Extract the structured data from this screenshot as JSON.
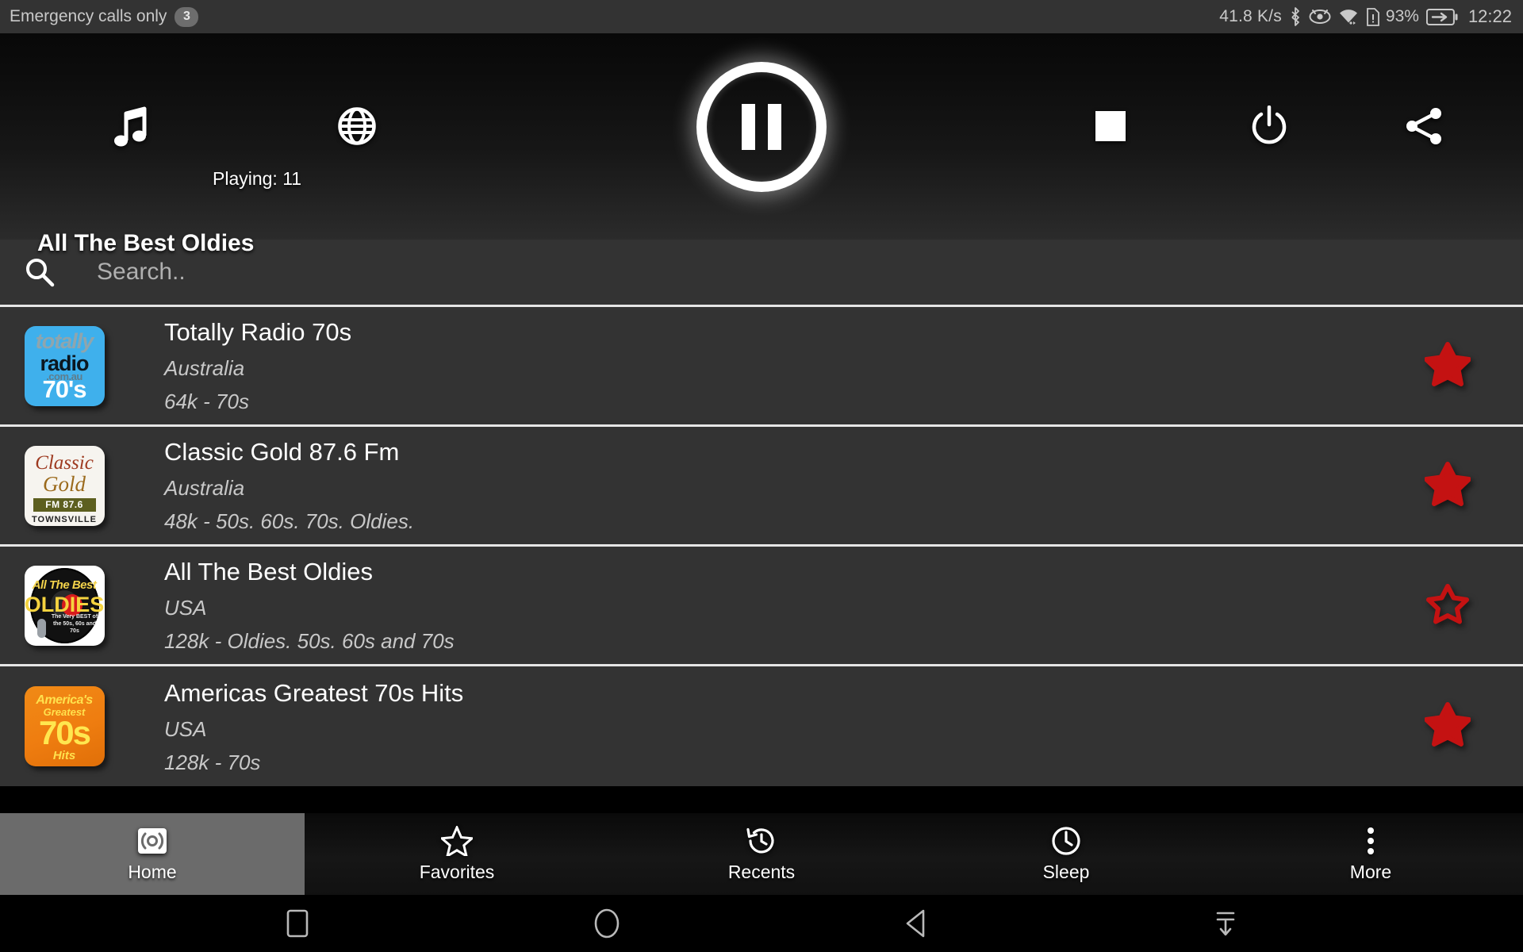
{
  "status_bar": {
    "carrier_text": "Emergency calls only",
    "badge": "3",
    "network_speed": "41.8 K/s",
    "battery_percent": "93%",
    "clock": "12:22",
    "icons": [
      "bluetooth-icon",
      "eye-icon",
      "wifi-icon",
      "sim-alert-icon",
      "battery-charging-icon"
    ]
  },
  "player": {
    "playing_label": "Playing: 11",
    "now_playing_title": "All The Best Oldies",
    "transport_state": "pause",
    "controls": {
      "music": "music-note-icon",
      "globe": "globe-icon",
      "play_pause": "pause-icon",
      "stop": "stop-icon",
      "power": "power-icon",
      "share": "share-icon"
    }
  },
  "search": {
    "placeholder": "Search..",
    "value": "",
    "icon": "search-icon"
  },
  "stations": [
    {
      "name": "Totally Radio 70s",
      "country": "Australia",
      "bitrate_genre": "64k - 70s",
      "favorite": true,
      "logo": {
        "type": "totally",
        "line1": "totally",
        "line2": "radio",
        "line3": ".com.au",
        "line4": "70's"
      }
    },
    {
      "name": "Classic Gold 87.6 Fm",
      "country": "Australia",
      "bitrate_genre": "48k - 50s. 60s. 70s. Oldies.",
      "favorite": true,
      "logo": {
        "type": "classic",
        "line1": "Classic",
        "line2": "Gold",
        "line3": "FM 87.6",
        "line4": "TOWNSVILLE"
      }
    },
    {
      "name": "All The Best Oldies",
      "country": "USA",
      "bitrate_genre": "128k - Oldies. 50s. 60s and 70s",
      "favorite": false,
      "logo": {
        "type": "oldies",
        "line1": "All The Best",
        "line2": "OLDIES",
        "line3": "The Very BEST of the 50s, 60s and 70s"
      }
    },
    {
      "name": "Americas Greatest 70s Hits",
      "country": "USA",
      "bitrate_genre": "128k - 70s",
      "favorite": true,
      "logo": {
        "type": "seventies",
        "line1": "America's",
        "line2": "Greatest",
        "line3": "70s",
        "line4": "Hits"
      }
    }
  ],
  "bottom_nav": {
    "items": [
      {
        "label": "Home",
        "icon": "broadcast-icon",
        "active": true
      },
      {
        "label": "Favorites",
        "icon": "star-outline-icon",
        "active": false
      },
      {
        "label": "Recents",
        "icon": "history-icon",
        "active": false
      },
      {
        "label": "Sleep",
        "icon": "clock-icon",
        "active": false
      },
      {
        "label": "More",
        "icon": "overflow-menu-icon",
        "active": false
      }
    ]
  },
  "android_nav": {
    "buttons": [
      "recents-square-icon",
      "home-circle-icon",
      "back-triangle-icon",
      "hide-navbar-icon"
    ]
  },
  "colors": {
    "favorite_star": "#c41212",
    "panel": "#333333",
    "status_bar": "#333333",
    "active_tab": "#6b6b6b"
  }
}
